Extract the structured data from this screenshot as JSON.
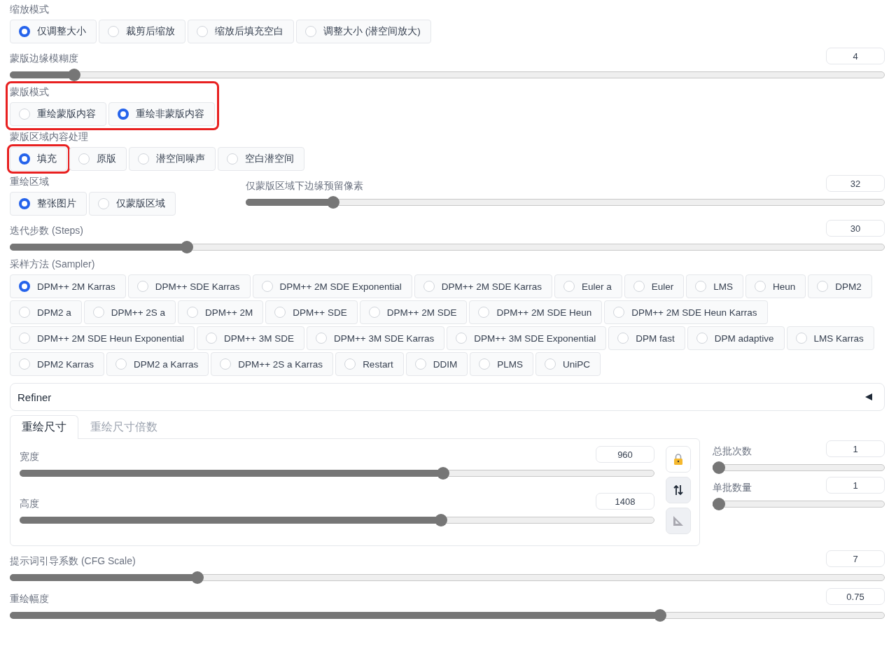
{
  "controls": [
    {
      "kind": "radio",
      "label": "缩放模式",
      "highlighted": false,
      "options": [
        {
          "label": "仅调整大小",
          "selected": true,
          "highlighted": false
        },
        {
          "label": "裁剪后缩放",
          "selected": false,
          "highlighted": false
        },
        {
          "label": "缩放后填充空白",
          "selected": false,
          "highlighted": false
        },
        {
          "label": "调整大小 (潜空间放大)",
          "selected": false,
          "highlighted": false
        }
      ]
    },
    {
      "kind": "slider",
      "label": "蒙版边缘模糊度",
      "value": "4",
      "level": 0.067
    },
    {
      "kind": "radio",
      "label": "蒙版模式",
      "highlighted": true,
      "options": [
        {
          "label": "重绘蒙版内容",
          "selected": false,
          "highlighted": false
        },
        {
          "label": "重绘非蒙版内容",
          "selected": true,
          "highlighted": false
        }
      ]
    },
    {
      "kind": "radio",
      "label": "蒙版区域内容处理",
      "highlighted": false,
      "options": [
        {
          "label": "填充",
          "selected": true,
          "highlighted": true
        },
        {
          "label": "原版",
          "selected": false,
          "highlighted": false
        },
        {
          "label": "潜空间噪声",
          "selected": false,
          "highlighted": false
        },
        {
          "label": "空白潜空间",
          "selected": false,
          "highlighted": false
        }
      ]
    },
    {
      "kind": "row",
      "items": [
        {
          "kind": "radio",
          "label": "重绘区域",
          "highlighted": false,
          "options": [
            {
              "label": "整张图片",
              "selected": true,
              "highlighted": false
            },
            {
              "label": "仅蒙版区域",
              "selected": false,
              "highlighted": false
            }
          ]
        },
        {
          "kind": "slider",
          "label": "仅蒙版区域下边缘预留像素",
          "value": "32",
          "level": 0.13
        }
      ]
    },
    {
      "kind": "slider",
      "label": "迭代步数 (Steps)",
      "value": "30",
      "level": 0.198
    },
    {
      "kind": "radio",
      "label": "采样方法 (Sampler)",
      "highlighted": false,
      "options": [
        {
          "label": "DPM++ 2M Karras",
          "selected": true,
          "highlighted": false
        },
        {
          "label": "DPM++ SDE Karras",
          "selected": false,
          "highlighted": false
        },
        {
          "label": "DPM++ 2M SDE Exponential",
          "selected": false,
          "highlighted": false
        },
        {
          "label": "DPM++ 2M SDE Karras",
          "selected": false,
          "highlighted": false
        },
        {
          "label": "Euler a",
          "selected": false,
          "highlighted": false
        },
        {
          "label": "Euler",
          "selected": false,
          "highlighted": false
        },
        {
          "label": "LMS",
          "selected": false,
          "highlighted": false
        },
        {
          "label": "Heun",
          "selected": false,
          "highlighted": false
        },
        {
          "label": "DPM2",
          "selected": false,
          "highlighted": false
        },
        {
          "label": "DPM2 a",
          "selected": false,
          "highlighted": false
        },
        {
          "label": "DPM++ 2S a",
          "selected": false,
          "highlighted": false
        },
        {
          "label": "DPM++ 2M",
          "selected": false,
          "highlighted": false
        },
        {
          "label": "DPM++ SDE",
          "selected": false,
          "highlighted": false
        },
        {
          "label": "DPM++ 2M SDE",
          "selected": false,
          "highlighted": false
        },
        {
          "label": "DPM++ 2M SDE Heun",
          "selected": false,
          "highlighted": false
        },
        {
          "label": "DPM++ 2M SDE Heun Karras",
          "selected": false,
          "highlighted": false
        },
        {
          "label": "DPM++ 2M SDE Heun Exponential",
          "selected": false,
          "highlighted": false
        },
        {
          "label": "DPM++ 3M SDE",
          "selected": false,
          "highlighted": false
        },
        {
          "label": "DPM++ 3M SDE Karras",
          "selected": false,
          "highlighted": false
        },
        {
          "label": "DPM++ 3M SDE Exponential",
          "selected": false,
          "highlighted": false
        },
        {
          "label": "DPM fast",
          "selected": false,
          "highlighted": false
        },
        {
          "label": "DPM adaptive",
          "selected": false,
          "highlighted": false
        },
        {
          "label": "LMS Karras",
          "selected": false,
          "highlighted": false
        },
        {
          "label": "DPM2 Karras",
          "selected": false,
          "highlighted": false
        },
        {
          "label": "DPM2 a Karras",
          "selected": false,
          "highlighted": false
        },
        {
          "label": "DPM++ 2S a Karras",
          "selected": false,
          "highlighted": false
        },
        {
          "label": "Restart",
          "selected": false,
          "highlighted": false
        },
        {
          "label": "DDIM",
          "selected": false,
          "highlighted": false
        },
        {
          "label": "PLMS",
          "selected": false,
          "highlighted": false
        },
        {
          "label": "UniPC",
          "selected": false,
          "highlighted": false
        }
      ]
    },
    {
      "kind": "accordion",
      "label": "Refiner",
      "expanded": false
    },
    {
      "kind": "size_panel",
      "tabs": [
        {
          "label": "重绘尺寸",
          "selected": true
        },
        {
          "label": "重绘尺寸倍数",
          "selected": false
        }
      ],
      "sliders": [
        {
          "label": "宽度",
          "value": "960",
          "level": 0.67
        },
        {
          "label": "高度",
          "value": "1408",
          "level": 0.667
        }
      ],
      "batch": [
        {
          "label": "总批次数",
          "value": "1",
          "level": 0
        },
        {
          "label": "单批数量",
          "value": "1",
          "level": 0
        }
      ]
    },
    {
      "kind": "slider",
      "label": "提示词引导系数 (CFG Scale)",
      "value": "7",
      "level": 0.21
    },
    {
      "kind": "slider",
      "label": "重绘幅度",
      "value": "0.75",
      "level": 0.747
    }
  ]
}
